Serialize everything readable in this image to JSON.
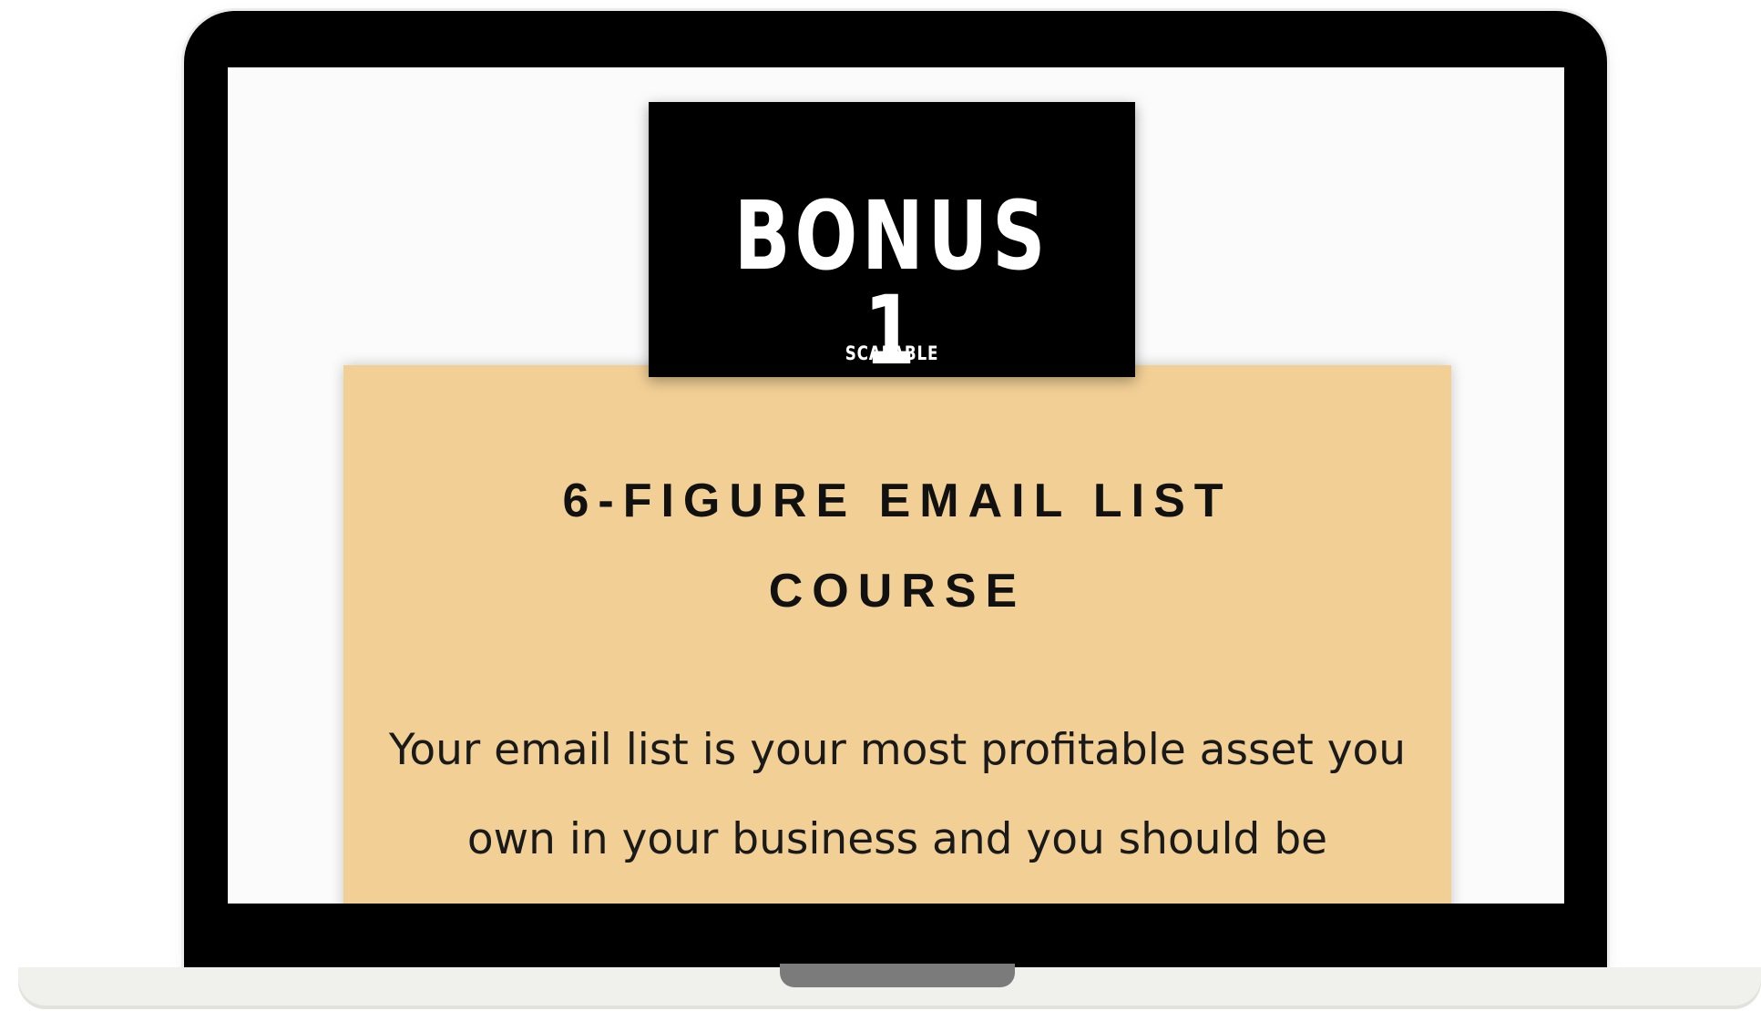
{
  "bonus": {
    "title": "BONUS 1",
    "brand": "SCALABLE"
  },
  "course": {
    "title_line1": "6-FIGURE EMAIL LIST",
    "title_line2": "COURSE",
    "description": "Your email list is your most profitable asset you own in your business and you should be growing it with soulmate clients. In this"
  },
  "colors": {
    "card_background": "#f1cf95",
    "badge_background": "#000000",
    "screen_background": "#fbfbfb"
  }
}
